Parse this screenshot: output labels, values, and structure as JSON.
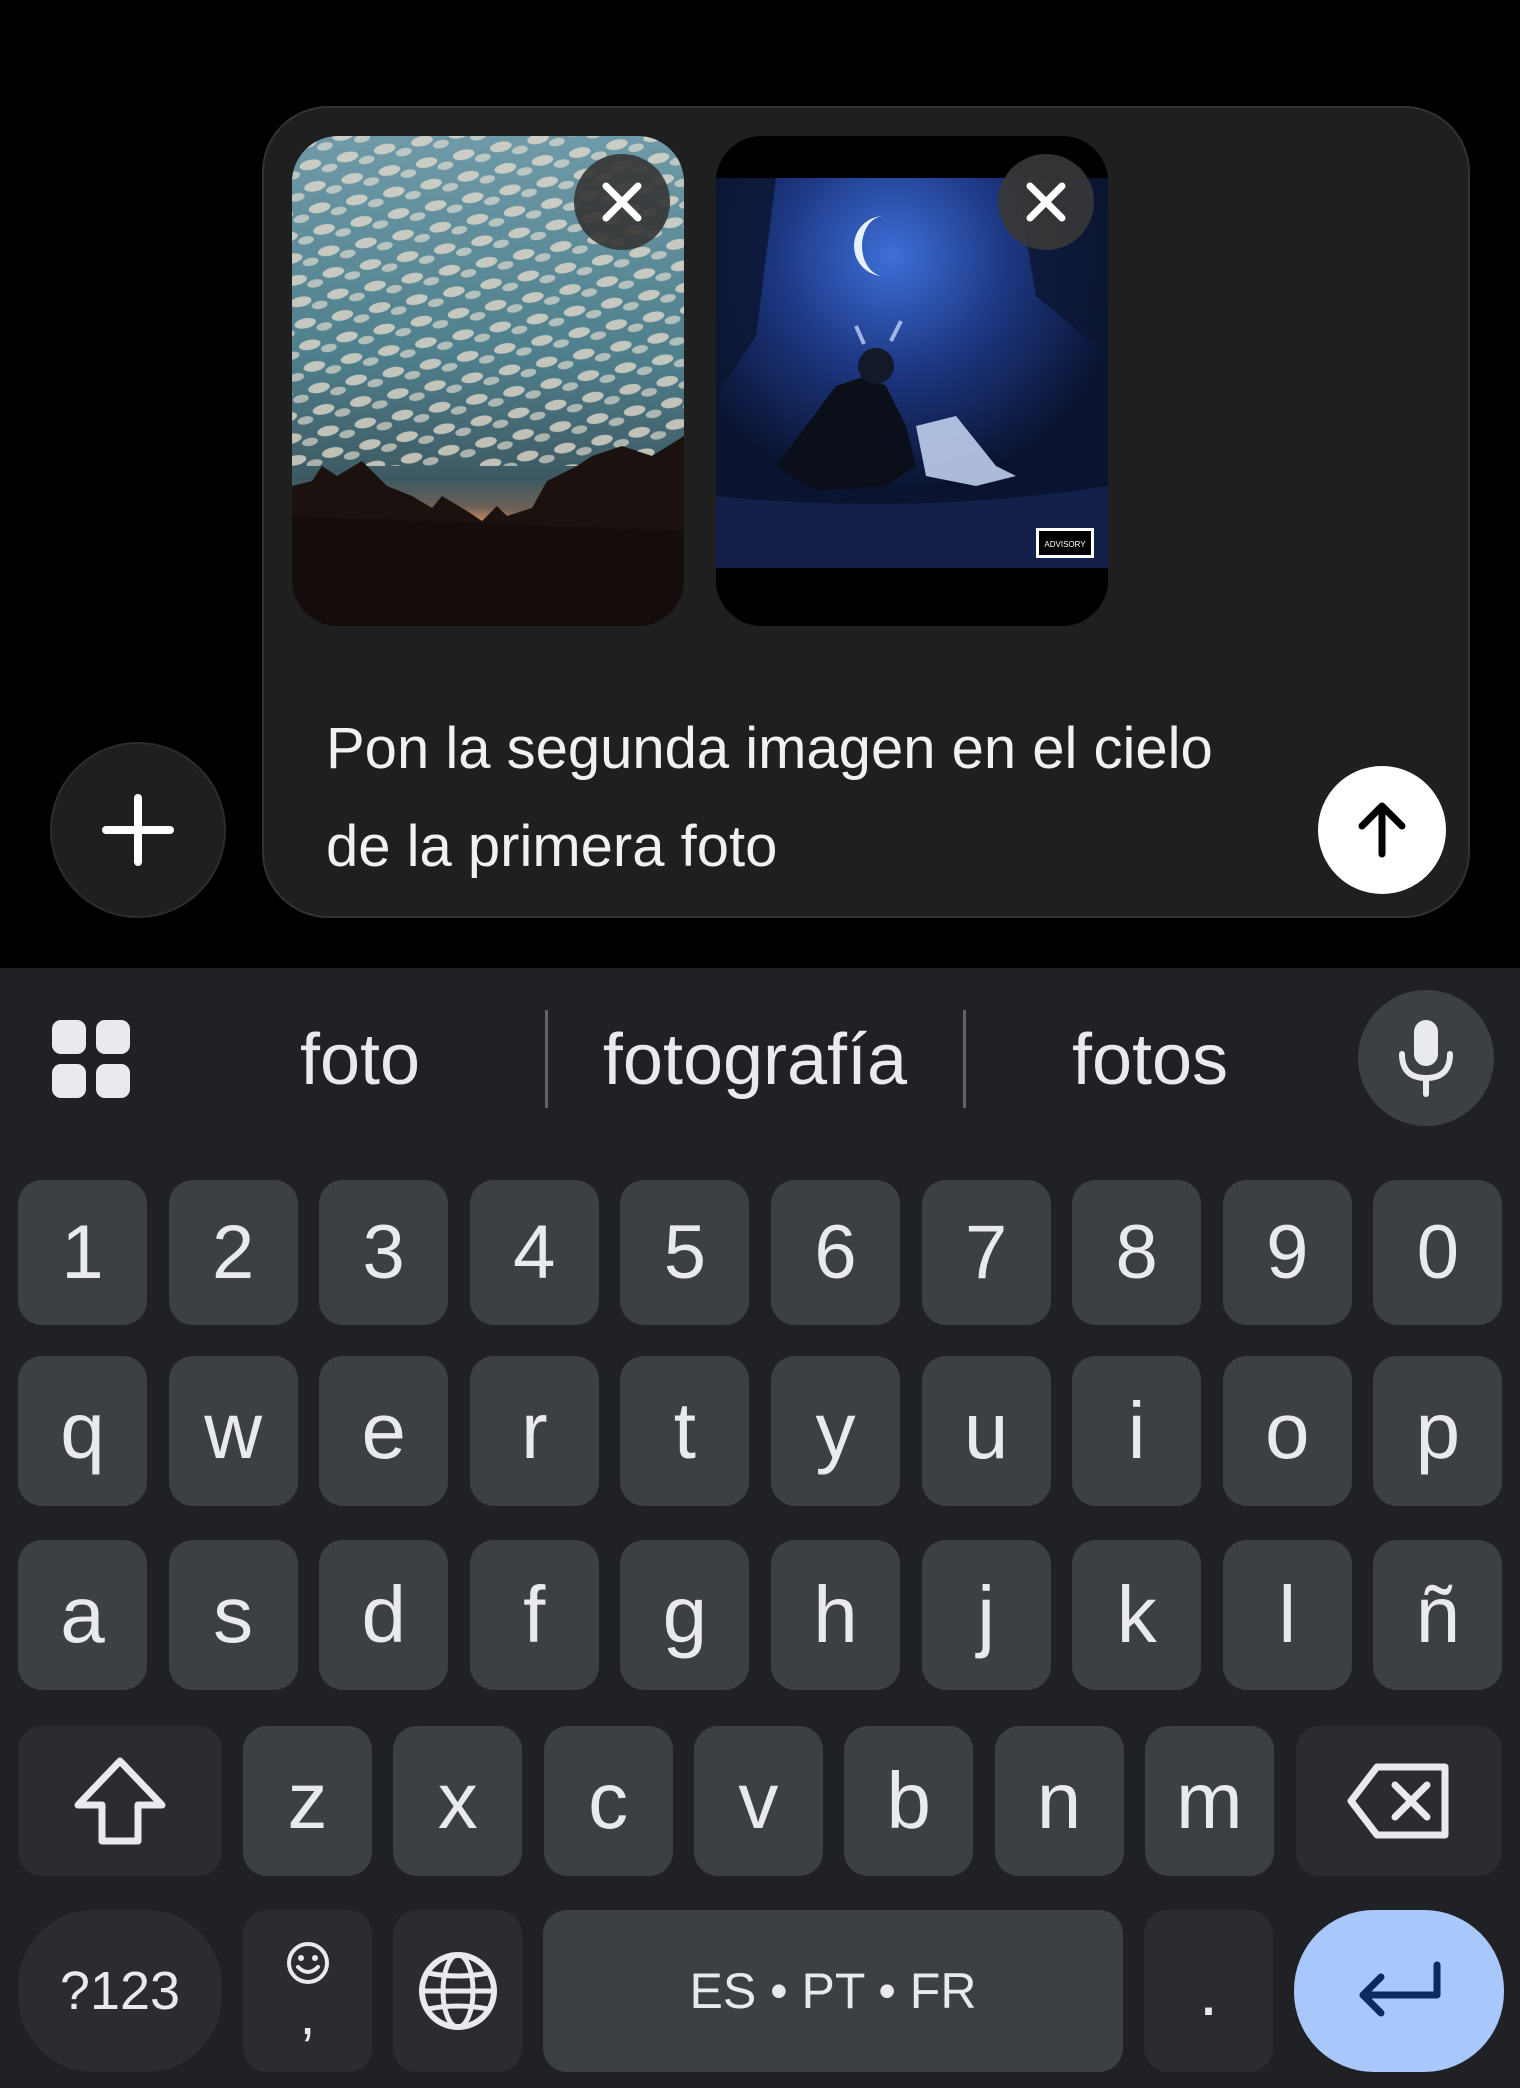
{
  "composer": {
    "prompt_text": "Pon la segunda imagen en el cielo de la primera foto",
    "attachments": [
      {
        "name": "attachment-sky-photo",
        "icon": "close-icon"
      },
      {
        "name": "attachment-album-cover",
        "icon": "close-icon",
        "badge": "PARENTAL ADVISORY EXPLICIT CONTENT"
      }
    ],
    "add_icon": "plus-icon",
    "send_icon": "arrow-up-icon"
  },
  "keyboard": {
    "suggestions": [
      "foto",
      "fotografía",
      "fotos"
    ],
    "number_row": [
      "1",
      "2",
      "3",
      "4",
      "5",
      "6",
      "7",
      "8",
      "9",
      "0"
    ],
    "row1": [
      "q",
      "w",
      "e",
      "r",
      "t",
      "y",
      "u",
      "i",
      "o",
      "p"
    ],
    "row2": [
      "a",
      "s",
      "d",
      "f",
      "g",
      "h",
      "j",
      "k",
      "l",
      "ñ"
    ],
    "row3": [
      "z",
      "x",
      "c",
      "v",
      "b",
      "n",
      "m"
    ],
    "symbols_label": "?123",
    "comma_label": ",",
    "space_label": "ES • PT • FR",
    "period_label": ".",
    "colors": {
      "keyboard_bg": "#202124",
      "key_bg": "#3c4043",
      "enter_bg": "#a8c7fa"
    }
  }
}
